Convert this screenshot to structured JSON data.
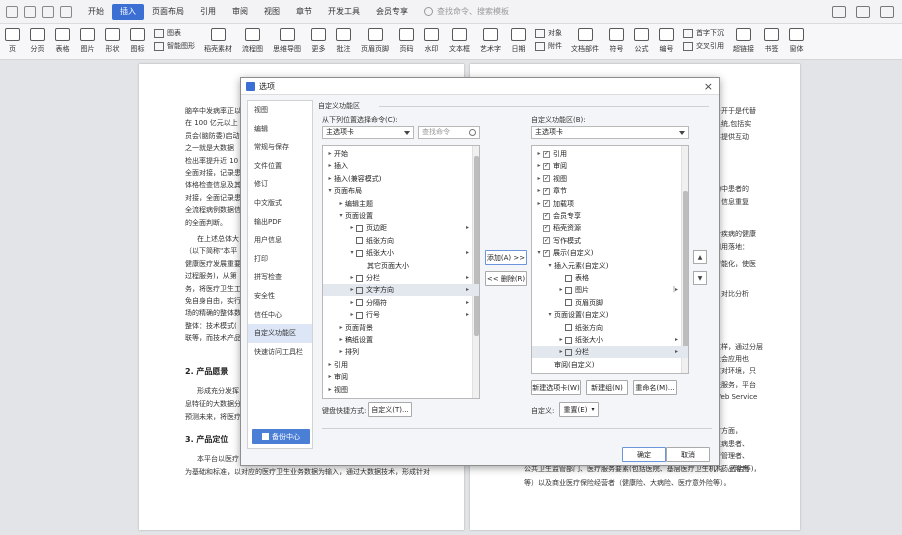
{
  "menu": {
    "tabs": [
      "开始",
      "插入",
      "页面布局",
      "引用",
      "审阅",
      "视图",
      "章节",
      "开发工具",
      "会员专享"
    ],
    "active_tab": "插入",
    "search_placeholder": "查找命令、搜索模板"
  },
  "ribbon": {
    "items": [
      "页",
      "分页",
      "表格",
      "图片",
      "形状",
      "图标",
      "稻壳素材",
      "流程图",
      "思维导图",
      "更多",
      "批注",
      "页眉页脚",
      "页码",
      "水印",
      "文本框",
      "艺术字",
      "日期",
      "文档部件",
      "符号",
      "公式",
      "编号",
      "超链接",
      "书签",
      "窗体"
    ],
    "small": [
      "图表",
      "智能图形",
      "对象",
      "附件",
      "首字下沉",
      "交叉引用"
    ]
  },
  "doc": {
    "left_lines": [
      "脑卒中发病率正以",
      "在 100 亿元以上",
      "员会(脑防委)启动",
      "之一就是大数据",
      "检出率提升近 10",
      "全面对接，记录患",
      "体格检查信息及其",
      "对接，全面记录患",
      "全流程病例数据信",
      "的全面判断。",
      "在上述总体大",
      "（以下简称\"本平",
      "健康医疗发展重要",
      "过程服务)，从第",
      "务，将医疗卫生工",
      "免自身自由，实行",
      "场的精确的整体数据",
      "整体：技术模式(",
      "联等，而技术产品"
    ],
    "right_lines": [
      "台开于是代替",
      "系统,包括实",
      "并提供互动",
      "构中患者的",
      "、信息重复",
      "合疾病的健康",
      "四用落地：",
      "智能化，使医",
      "、对比分析",
      "这样，通过分层",
      "社会应用也",
      "信对环境，只",
      "联服务，平台",
      "Web Service",
      "疗方面，",
      "性病患者、",
      "管管理者、",
      "、药品零售"
    ],
    "heading1": "2.  产品愿景",
    "heading1_text": [
      "形成充分发挥",
      "息特征的大数据分",
      "预测未来，将医疗"
    ],
    "heading2": "3.  产品定位",
    "bottom_left": [
      "本平台以医疗",
      "为基础和标准，以对应的医疗卫生业务数据为输入，通过大数据技术，形成针对"
    ],
    "bottom_right": [
      "公共卫生监管部门、医疗服务要素(包括医院、基层医疗卫生机构、药店等)，",
      "等）以及商业医疗保险经营者（健康险、大病险、医疗意外险等）。"
    ]
  },
  "dialog": {
    "title": "选项",
    "close": "×",
    "sidebar": [
      "视图",
      "编辑",
      "常规与保存",
      "文件位置",
      "修订",
      "中文版式",
      "输出PDF",
      "用户信息",
      "打印",
      "拼写检查",
      "安全性",
      "信任中心",
      "自定义功能区",
      "快速访问工具栏"
    ],
    "sidebar_selected": "自定义功能区",
    "backup": "备份中心",
    "section_title": "自定义功能区",
    "from_label": "从下列位置选择命令(C):",
    "from_value": "主选项卡",
    "search_placeholder": "查找命令",
    "left_tree": [
      {
        "indent": 0,
        "arrow": "▸",
        "text": "开始"
      },
      {
        "indent": 0,
        "arrow": "▸",
        "text": "插入"
      },
      {
        "indent": 0,
        "arrow": "▸",
        "text": "插入(兼容模式)"
      },
      {
        "indent": 0,
        "arrow": "▾",
        "text": "页面布局"
      },
      {
        "indent": 1,
        "arrow": "▸",
        "text": "编辑主题"
      },
      {
        "indent": 1,
        "arrow": "▾",
        "text": "页面设置"
      },
      {
        "indent": 2,
        "arrow": "▸",
        "icon": true,
        "text": "页边距",
        "sub": "▸"
      },
      {
        "indent": 2,
        "arrow": "",
        "icon": true,
        "text": "纸张方向"
      },
      {
        "indent": 2,
        "arrow": "▾",
        "icon": true,
        "text": "纸张大小",
        "sub": "▸"
      },
      {
        "indent": 3,
        "arrow": "",
        "text": "其它页面大小"
      },
      {
        "indent": 2,
        "arrow": "▸",
        "icon": true,
        "text": "分栏",
        "sub": "▸"
      },
      {
        "indent": 2,
        "arrow": "▸",
        "icon": true,
        "text": "文字方向",
        "sub": "▸",
        "selected": true
      },
      {
        "indent": 2,
        "arrow": "▸",
        "icon": true,
        "text": "分隔符",
        "sub": "▸"
      },
      {
        "indent": 2,
        "arrow": "▸",
        "icon": true,
        "text": "行号",
        "sub": "▸"
      },
      {
        "indent": 1,
        "arrow": "▸",
        "text": "页面背景"
      },
      {
        "indent": 1,
        "arrow": "▸",
        "text": "稿纸设置"
      },
      {
        "indent": 1,
        "arrow": "▸",
        "text": "排列"
      },
      {
        "indent": 0,
        "arrow": "▸",
        "text": "引用"
      },
      {
        "indent": 0,
        "arrow": "▸",
        "text": "审阅"
      },
      {
        "indent": 0,
        "arrow": "▸",
        "text": "视图"
      }
    ],
    "add_btn": "添加(A) >>",
    "remove_btn": "<< 删除(R)",
    "to_label": "自定义功能区(B):",
    "to_value": "主选项卡",
    "right_tree": [
      {
        "indent": 0,
        "arrow": "▸",
        "check": true,
        "text": "引用"
      },
      {
        "indent": 0,
        "arrow": "▸",
        "check": true,
        "text": "审阅"
      },
      {
        "indent": 0,
        "arrow": "▸",
        "check": true,
        "text": "视图"
      },
      {
        "indent": 0,
        "arrow": "▸",
        "check": true,
        "text": "章节"
      },
      {
        "indent": 0,
        "arrow": "▸",
        "check": true,
        "text": "加载项"
      },
      {
        "indent": 0,
        "arrow": "",
        "check": true,
        "text": "会员专享"
      },
      {
        "indent": 0,
        "arrow": "",
        "check": true,
        "text": "稻壳资源"
      },
      {
        "indent": 0,
        "arrow": "",
        "check": true,
        "text": "写作模式"
      },
      {
        "indent": 0,
        "arrow": "▾",
        "check": true,
        "text": "展示(自定义)"
      },
      {
        "indent": 1,
        "arrow": "▾",
        "text": "插入元素(自定义)"
      },
      {
        "indent": 2,
        "arrow": "",
        "icon": true,
        "text": "表格"
      },
      {
        "indent": 2,
        "arrow": "▸",
        "icon": true,
        "text": "图片",
        "sub": "|▸"
      },
      {
        "indent": 2,
        "arrow": "",
        "icon": true,
        "text": "页眉页脚"
      },
      {
        "indent": 1,
        "arrow": "▾",
        "text": "页面设置(自定义)"
      },
      {
        "indent": 2,
        "arrow": "",
        "icon": true,
        "text": "纸张方向"
      },
      {
        "indent": 2,
        "arrow": "▸",
        "icon": true,
        "text": "纸张大小",
        "sub": "▸"
      },
      {
        "indent": 2,
        "arrow": "▸",
        "icon": true,
        "text": "分栏",
        "sub": "▸",
        "selected": true
      },
      {
        "indent": 1,
        "arrow": "",
        "text": "审阅(自定义)"
      }
    ],
    "new_tab": "新建选项卡(W)",
    "new_group": "新建组(N)",
    "rename": "重命名(M)...",
    "custom_label": "自定义:",
    "reset": "重置(E)",
    "shortcut_label": "键盘快捷方式:",
    "shortcut_btn": "自定义(T)...",
    "ok": "确定",
    "cancel": "取消"
  }
}
